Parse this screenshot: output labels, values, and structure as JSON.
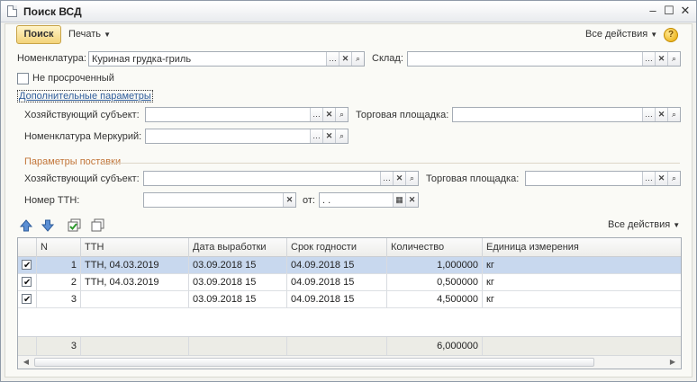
{
  "window": {
    "title": "Поиск ВСД"
  },
  "toolbar": {
    "search_label": "Поиск",
    "print_label": "Печать",
    "all_actions_label": "Все действия",
    "help_label": "?"
  },
  "form": {
    "nomenclature_label": "Номенклатура:",
    "nomenclature_value": "Куриная грудка-гриль",
    "warehouse_label": "Склад:",
    "warehouse_value": "",
    "not_expired_label": "Не просроченный",
    "advanced_link": "Дополнительные параметры",
    "economic_entity_label": "Хозяйствующий субъект:",
    "economic_entity_value": "",
    "trade_area_label": "Торговая площадка:",
    "trade_area_value": "",
    "mercury_nomenclature_label": "Номенклатура Меркурий:",
    "mercury_nomenclature_value": ""
  },
  "delivery": {
    "section_title": "Параметры поставки",
    "economic_entity_label": "Хозяйствующий субъект:",
    "economic_entity_value": "",
    "trade_area_label": "Торговая площадка:",
    "trade_area_value": "",
    "ttn_number_label": "Номер ТТН:",
    "ttn_number_value": "",
    "from_label": "от:",
    "from_value": " .  ."
  },
  "table_toolbar": {
    "all_actions_label": "Все действия"
  },
  "table": {
    "columns": [
      "N",
      "ТТН",
      "Дата выработки",
      "Срок годности",
      "Количество",
      "Единица измерения"
    ],
    "rows": [
      {
        "checked": true,
        "n": "1",
        "ttn": "ТТН, 04.03.2019",
        "production_date": "03.09.2018 15",
        "expiry": "04.09.2018 15",
        "quantity": "1,000000",
        "unit": "кг"
      },
      {
        "checked": true,
        "n": "2",
        "ttn": "ТТН, 04.03.2019",
        "production_date": "03.09.2018 15",
        "expiry": "04.09.2018 15",
        "quantity": "0,500000",
        "unit": "кг"
      },
      {
        "checked": true,
        "n": "3",
        "ttn": "",
        "production_date": "03.09.2018 15",
        "expiry": "04.09.2018 15",
        "quantity": "4,500000",
        "unit": "кг"
      }
    ],
    "footer": {
      "count": "3",
      "quantity_total": "6,000000"
    }
  }
}
